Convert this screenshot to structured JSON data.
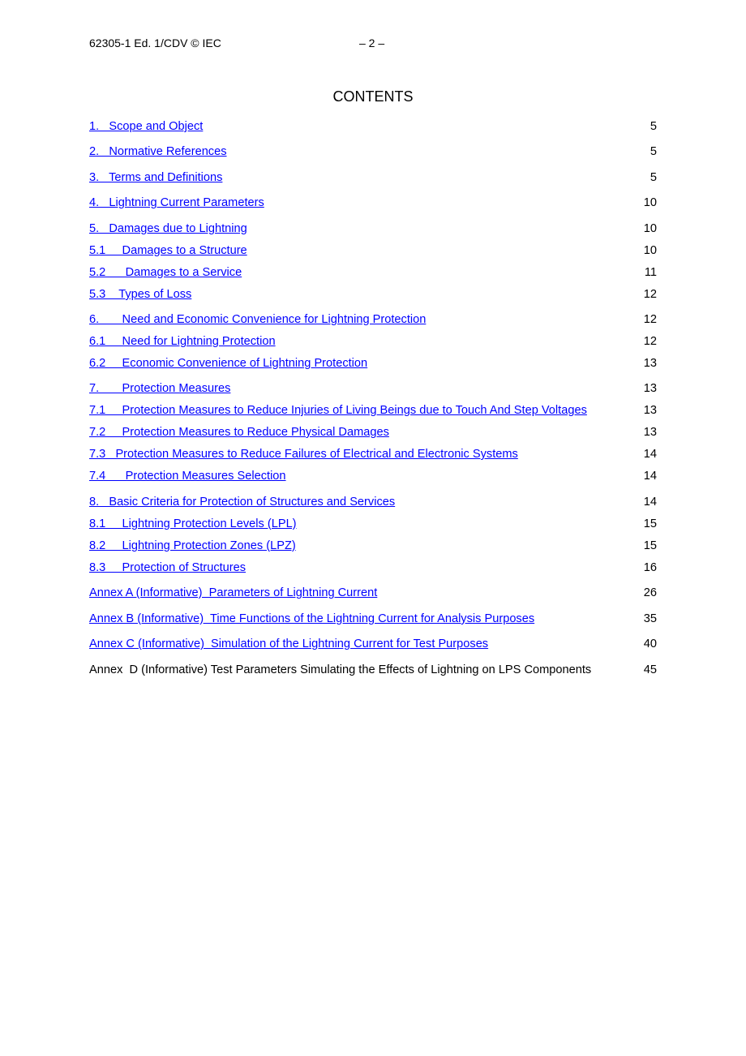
{
  "header": {
    "doc_id": "62305-1 Ed. 1/CDV © IEC",
    "page": "– 2 –"
  },
  "title": "CONTENTS",
  "colors": {
    "link": "#0000ff",
    "text": "#000000"
  },
  "toc": [
    {
      "label": "1.   Scope and Object",
      "page": "5",
      "link": true
    },
    {
      "label": "2.   Normative References",
      "page": "5",
      "link": true
    },
    {
      "label": "3.   Terms and Definitions",
      "page": "5",
      "link": true
    },
    {
      "label": "4.   Lightning Current Parameters",
      "page": "10",
      "link": true
    },
    {
      "label": "5.   Damages due to Lightning",
      "page": "10",
      "link": true
    },
    {
      "label": "5.1     Damages to a Structure",
      "page": "10",
      "link": true
    },
    {
      "label": "5.2      Damages to a Service",
      "page": "11",
      "link": true
    },
    {
      "label": "5.3    Types of Loss",
      "page": "12",
      "link": true
    },
    {
      "label": "6.       Need and Economic Convenience for Lightning Protection",
      "page": "12",
      "link": true
    },
    {
      "label": "6.1     Need for Lightning Protection",
      "page": "12",
      "link": true
    },
    {
      "label": "6.2     Economic Convenience of Lightning Protection",
      "page": "13",
      "link": true
    },
    {
      "label": "7.       Protection Measures",
      "page": "13",
      "link": true
    },
    {
      "label": "7.1     Protection Measures to Reduce Injuries of Living Beings due to Touch And Step Voltages",
      "page": "13",
      "link": true
    },
    {
      "label": "7.2     Protection Measures to Reduce Physical Damages",
      "page": "13",
      "link": true
    },
    {
      "label": "7.3   Protection Measures to Reduce Failures of Electrical and Electronic Systems",
      "page": "14",
      "link": true
    },
    {
      "label": "7.4      Protection Measures Selection",
      "page": "14",
      "link": true
    },
    {
      "label": "8.   Basic Criteria for Protection of Structures and Services",
      "page": "14",
      "link": true
    },
    {
      "label": "8.1     Lightning Protection Levels (LPL)",
      "page": "15",
      "link": true
    },
    {
      "label": "8.2     Lightning Protection Zones (LPZ)",
      "page": "15",
      "link": true
    },
    {
      "label": "8.3     Protection of Structures",
      "page": "16",
      "link": true
    },
    {
      "label": "Annex A (Informative)  Parameters of Lightning Current",
      "page": "26",
      "link": true
    },
    {
      "label": "Annex B (Informative)  Time Functions of the Lightning Current for Analysis Purposes",
      "page": "35",
      "link": true
    },
    {
      "label": "Annex C (Informative)  Simulation of the Lightning Current for Test Purposes",
      "page": "40",
      "link": true
    },
    {
      "label": "Annex  D (Informative) Test Parameters Simulating the Effects of Lightning on LPS Components",
      "page": "45",
      "link": false
    }
  ]
}
